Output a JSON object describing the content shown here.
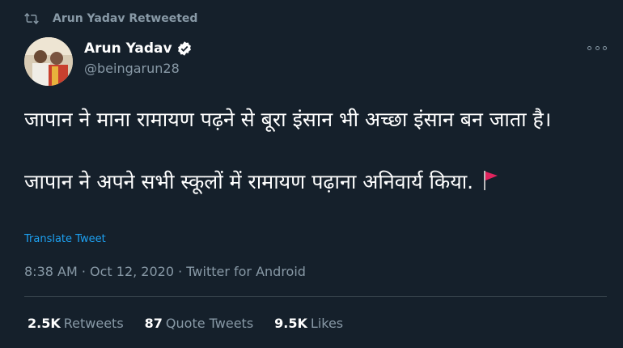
{
  "retweet": {
    "text": "Arun Yadav Retweeted"
  },
  "author": {
    "name": "Arun Yadav",
    "handle": "@beingarun28"
  },
  "tweet": {
    "line1": "जापान ने माना रामायण पढ़ने से बूरा इंसान भी अच्छा इंसान बन जाता है।",
    "line2": "जापान ने अपने सभी स्कूलों में रामायण पढ़ाना अनिवार्य किया."
  },
  "translate_label": "Translate Tweet",
  "meta": {
    "time": "8:38 AM · Oct 12, 2020 · Twitter for Android"
  },
  "stats": [
    {
      "count": "2.5K",
      "label": "Retweets"
    },
    {
      "count": "87",
      "label": "Quote Tweets"
    },
    {
      "count": "9.5K",
      "label": "Likes"
    }
  ],
  "colors": {
    "background": "#15202b",
    "muted": "#8899a6",
    "link": "#1da1f2",
    "verified": "#ffffff",
    "flag": "#e0245e"
  },
  "icons": {
    "retweet": "retweet-icon",
    "verified": "verified-badge-icon",
    "more": "more-options-icon",
    "flag": "red-flag-icon"
  }
}
